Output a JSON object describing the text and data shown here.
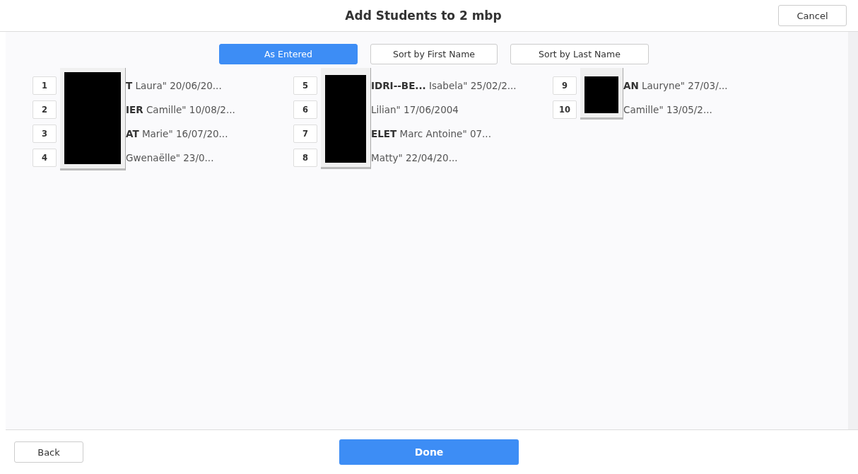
{
  "title": "Add Students to 2 mbp",
  "cancel": "Cancel",
  "sort_buttons": [
    {
      "label": "As Entered",
      "selected": true
    },
    {
      "label": "Sort by First Name",
      "selected": false
    },
    {
      "label": "Sort by Last Name",
      "selected": false
    }
  ],
  "columns": [
    {
      "students": [
        {
          "number": "1",
          "text": "**T** Laura\" 20/06/20..."
        },
        {
          "number": "2",
          "text": "**IER** Camille\" 10/08/2..."
        },
        {
          "number": "3",
          "text": "**AT** Marie\" 16/07/20..."
        },
        {
          "number": "4",
          "text": "Gwenaëlle\" 23/0..."
        }
      ]
    },
    {
      "students": [
        {
          "number": "5",
          "text": "**IDRI--BE...** Isabela\" 25/02/2..."
        },
        {
          "number": "6",
          "text": "Lilian\" 17/06/2004"
        },
        {
          "number": "7",
          "text": "**ELET** Marc Antoine\" 07..."
        },
        {
          "number": "8",
          "text": "Matty\" 22/04/20..."
        }
      ]
    },
    {
      "students": [
        {
          "number": "9",
          "text": "**AN** Lauryne\" 27/03/..."
        },
        {
          "number": "10",
          "text": "Camille\" 13/05/2..."
        }
      ]
    }
  ],
  "back": "Back",
  "done": "Done"
}
